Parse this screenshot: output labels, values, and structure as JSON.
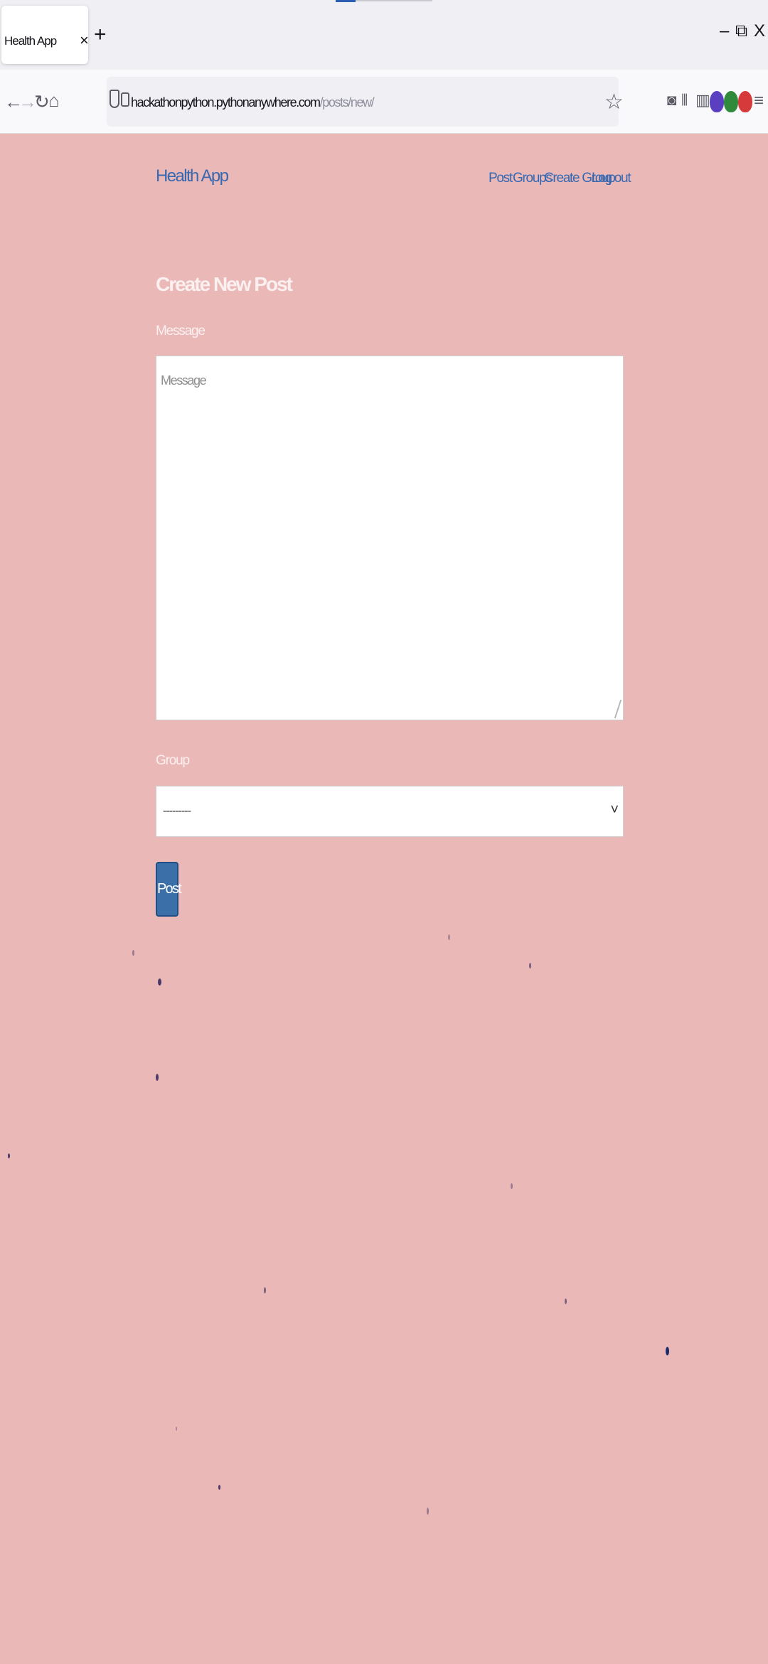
{
  "browser": {
    "tab_title": "Health App",
    "tab_close": "×",
    "new_tab": "+",
    "minimize": "–",
    "restore": "⧉",
    "close": "X",
    "url_host": "hackathonpython.pythonanywhere.com",
    "url_path": "/posts/new/",
    "icons": [
      "back-icon",
      "forward-icon",
      "reload-icon",
      "home-icon",
      "bookmark-star-icon",
      "pocket-icon",
      "library-icon",
      "reader-icon",
      "extension-icons",
      "menu-icon"
    ]
  },
  "site": {
    "brand": "Health App",
    "nav": [
      "Post",
      "Groups",
      "Create Group",
      "Log out"
    ]
  },
  "form": {
    "heading": "Create New Post",
    "message_label": "Message",
    "message_placeholder": "Message",
    "group_label": "Group",
    "group_selected": "---------",
    "submit_label": "Post"
  },
  "colors": {
    "page_background": "#ebb8b8",
    "link": "#3768b0",
    "button": "#3a6fa8"
  }
}
